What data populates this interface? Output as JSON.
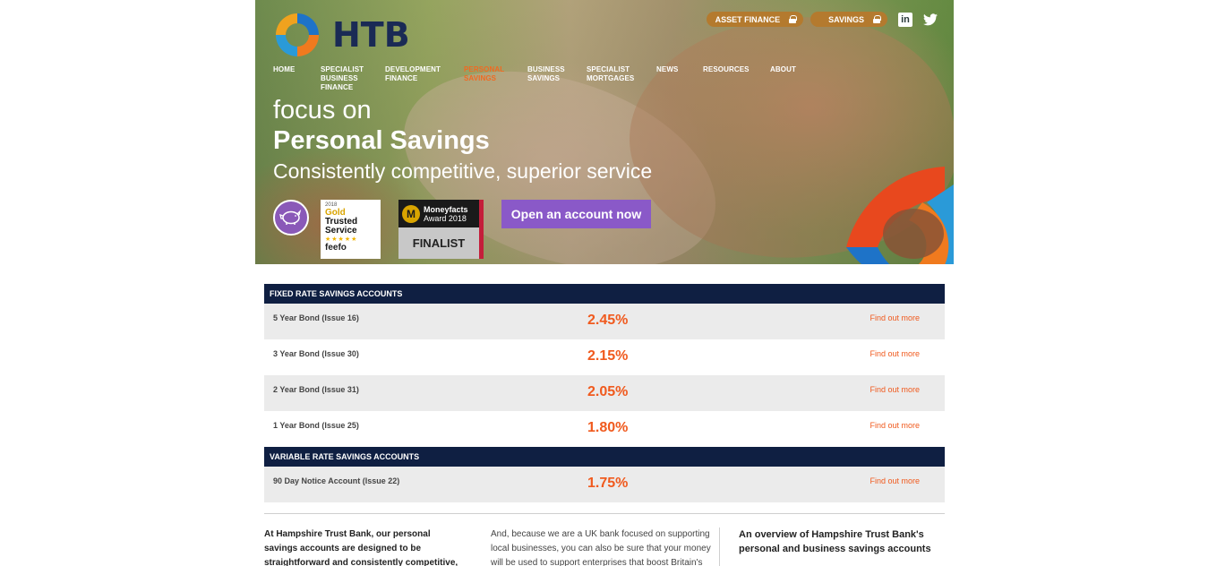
{
  "brand": {
    "name": "HTB"
  },
  "top_buttons": [
    {
      "label": "ASSET FINANCE"
    },
    {
      "label": "SAVINGS"
    }
  ],
  "social": {
    "linkedin": "in",
    "twitter": "twitter-icon"
  },
  "nav": [
    {
      "label": "HOME"
    },
    {
      "label": "SPECIALIST BUSINESS FINANCE"
    },
    {
      "label": "DEVELOPMENT FINANCE"
    },
    {
      "label": "PERSONAL SAVINGS",
      "active": true
    },
    {
      "label": "BUSINESS SAVINGS"
    },
    {
      "label": "SPECIALIST MORTGAGES"
    },
    {
      "label": "NEWS"
    },
    {
      "label": "RESOURCES"
    },
    {
      "label": "ABOUT"
    }
  ],
  "hero": {
    "line1": "focus on",
    "line2": "Personal Savings",
    "line3": "Consistently competitive, superior service",
    "cta": "Open an account now"
  },
  "badges": {
    "feefo": {
      "year": "2018",
      "gold": "Gold",
      "trusted": "Trusted",
      "service": "Service",
      "stars": "★★★★★",
      "brand": "feefo"
    },
    "moneyfacts": {
      "m": "M",
      "title": "Moneyfacts",
      "award": "Award 2018",
      "status": "FINALIST"
    }
  },
  "fixed": {
    "heading": "FIXED RATE SAVINGS ACCOUNTS",
    "rows": [
      {
        "name": "5 Year Bond (Issue 16)",
        "rate": "2.45%",
        "link": "Find out more"
      },
      {
        "name": "3 Year Bond (Issue 30)",
        "rate": "2.15%",
        "link": "Find out more"
      },
      {
        "name": "2 Year Bond (Issue 31)",
        "rate": "2.05%",
        "link": "Find out more"
      },
      {
        "name": "1 Year Bond (Issue 25)",
        "rate": "1.80%",
        "link": "Find out more"
      }
    ]
  },
  "variable": {
    "heading": "VARIABLE RATE SAVINGS ACCOUNTS",
    "rows": [
      {
        "name": "90 Day Notice Account (Issue 22)",
        "rate": "1.75%",
        "link": "Find out more"
      }
    ]
  },
  "content": {
    "col1": "At Hampshire Trust Bank, our personal savings accounts are designed to be straightforward and consistently competitive, giving you the",
    "col2": "And, because we are a UK bank focused on supporting local businesses, you can also be sure that your money will be used to support enterprises that boost Britain's",
    "col3": "An overview of Hampshire Trust Bank's personal and business savings accounts"
  },
  "colors": {
    "navy": "#0f1f42",
    "orange": "#f05a1e",
    "purple": "#8a59c8",
    "gold": "#b47a2e"
  }
}
